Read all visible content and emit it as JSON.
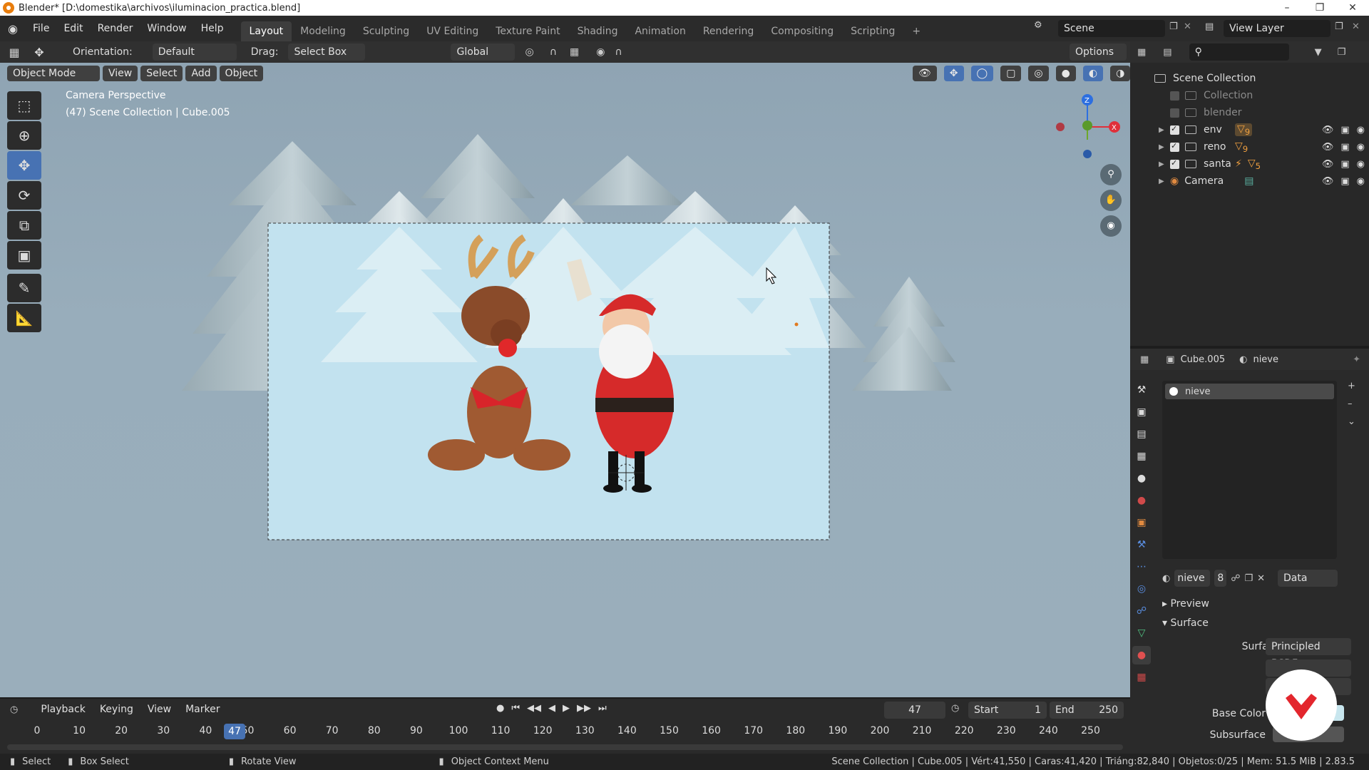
{
  "titlebar": {
    "title": "Blender* [D:\\domestika\\archivos\\iluminacion_practica.blend]"
  },
  "menu": [
    "File",
    "Edit",
    "Render",
    "Window",
    "Help"
  ],
  "workspaces": [
    "Layout",
    "Modeling",
    "Sculpting",
    "UV Editing",
    "Texture Paint",
    "Shading",
    "Animation",
    "Rendering",
    "Compositing",
    "Scripting"
  ],
  "active_workspace": "Layout",
  "scene_field": "Scene",
  "view_layer_field": "View Layer",
  "tool_header": {
    "orientation_label": "Orientation:",
    "orientation_value": "Default",
    "drag_label": "Drag:",
    "drag_value": "Select Box",
    "transform_value": "Global",
    "options": "Options"
  },
  "viewport_header": {
    "mode": "Object Mode",
    "view": "View",
    "select": "Select",
    "add": "Add",
    "object": "Object"
  },
  "viewport": {
    "perspective_label": "Camera Perspective",
    "context_label": "(47) Scene Collection | Cube.005",
    "gizmo_z": "Z",
    "gizmo_x": "X"
  },
  "outliner": {
    "root": "Scene Collection",
    "items": [
      {
        "label": "Collection",
        "checked": false,
        "dim": true
      },
      {
        "label": "blender",
        "checked": false,
        "dim": true
      },
      {
        "label": "env",
        "checked": true,
        "dim": false,
        "badge": "9"
      },
      {
        "label": "reno",
        "checked": true,
        "dim": false,
        "badge": "9"
      },
      {
        "label": "santa",
        "checked": true,
        "dim": false,
        "badge": "5"
      },
      {
        "label": "Camera",
        "checked": false,
        "dim": false
      }
    ]
  },
  "properties": {
    "object_name": "Cube.005",
    "material_name": "nieve",
    "slot_label": "nieve",
    "material_field": "nieve",
    "users": "8",
    "link": "Data",
    "preview": "Preview",
    "surface_section": "Surface",
    "surface_label": "Surface",
    "surface_value": "Principled BSDF",
    "base_color_label": "Base Color",
    "subsurface_label": "Subsurface"
  },
  "timeline": {
    "playback": "Playback",
    "keying": "Keying",
    "view": "View",
    "marker": "Marker",
    "current_frame": "47",
    "start_label": "Start",
    "start": "1",
    "end_label": "End",
    "end": "250",
    "ticks": [
      "0",
      "10",
      "20",
      "30",
      "40",
      "50",
      "60",
      "70",
      "80",
      "90",
      "100",
      "110",
      "120",
      "130",
      "140",
      "150",
      "160",
      "170",
      "180",
      "190",
      "200",
      "210",
      "220",
      "230",
      "240",
      "250"
    ]
  },
  "statusbar": {
    "select": "Select",
    "box_select": "Box Select",
    "rotate_view": "Rotate View",
    "context_menu": "Object Context Menu",
    "stats": "Scene Collection | Cube.005 | Vért:41,550 | Caras:41,420 | Triáng:82,840 | Objetos:0/25 | Mem: 51.5 MiB | 2.83.5"
  },
  "colors": {
    "accent": "#4772b3",
    "sky": "#c2e2ef",
    "bg": "#98adbb"
  }
}
